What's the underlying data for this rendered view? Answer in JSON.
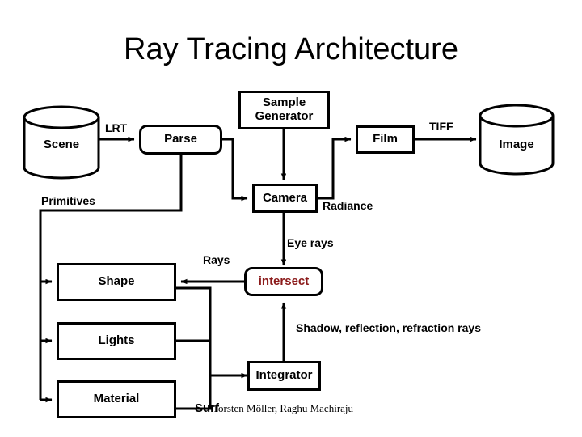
{
  "slide": {
    "title": "Ray Tracing Architecture",
    "credit": "Torsten Möller, Raghu Machiraju",
    "accent_color": "#8B1A1A",
    "line_color": "#000000",
    "background": "#ffffff"
  },
  "datastores": [
    {
      "id": "scene",
      "label": "Scene"
    },
    {
      "id": "image",
      "label": "Image"
    }
  ],
  "nodes": [
    {
      "id": "parse",
      "label": "Parse"
    },
    {
      "id": "sample_generator",
      "label": "Sample\nGenerator",
      "line1": "Sample",
      "line2": "Generator"
    },
    {
      "id": "camera",
      "label": "Camera"
    },
    {
      "id": "film",
      "label": "Film"
    },
    {
      "id": "intersect",
      "label": "intersect"
    },
    {
      "id": "shape",
      "label": "Shape"
    },
    {
      "id": "lights",
      "label": "Lights"
    },
    {
      "id": "material",
      "label": "Material"
    },
    {
      "id": "integrator",
      "label": "Integrator"
    }
  ],
  "edge_labels": {
    "lrt": "LRT",
    "primitives": "Primitives",
    "radiance": "Radiance",
    "tiff": "TIFF",
    "eye_rays": "Eye rays",
    "rays": "Rays",
    "shadow_reflection": "Shadow, reflection, refraction rays",
    "surf": "Surf"
  }
}
